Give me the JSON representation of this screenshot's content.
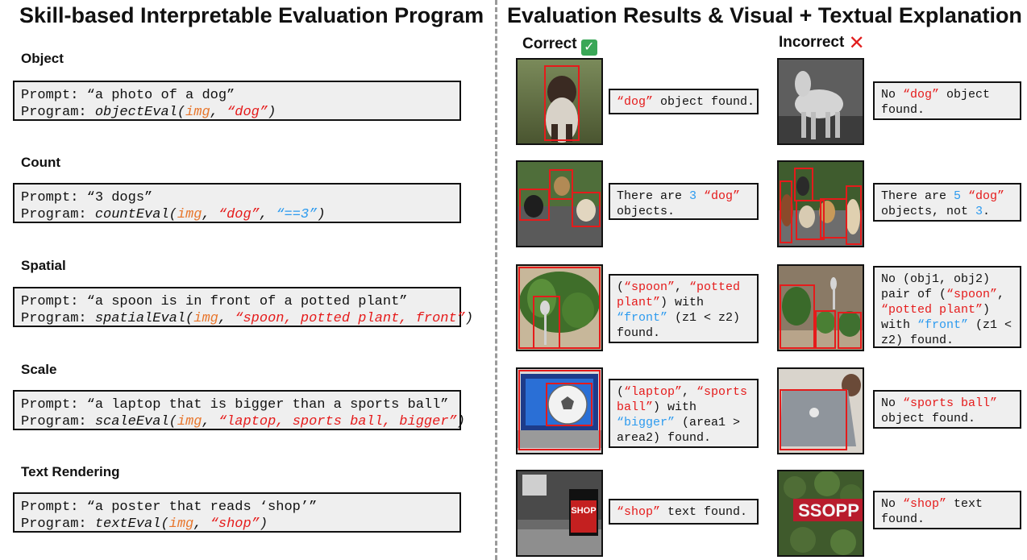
{
  "left_title": "Skill-based Interpretable Evaluation Program",
  "right_title": "Evaluation Results & Visual + Textual Explanation",
  "col_correct": "Correct",
  "col_incorrect": "Incorrect",
  "icons": {
    "correct": "check-mark-icon",
    "incorrect": "cross-mark-icon"
  },
  "colors": {
    "accent_red": "#e51b1b",
    "accent_blue": "#2d9bef",
    "accent_orange": "#e8762c"
  },
  "common": {
    "prompt_label": "Prompt:",
    "program_label": "Program:",
    "img_arg": "img",
    "comma": ", ",
    "close_paren": ")"
  },
  "skills": [
    {
      "name": "Object",
      "prompt": "“a photo of a dog”",
      "func": "objectEval(",
      "arg1": "“dog”",
      "correct": {
        "t1": "“dog”",
        "t2": " object found."
      },
      "incorrect": {
        "l1a": "No ",
        "l1b": "“dog”",
        "l1c": " object",
        "l2": "found."
      }
    },
    {
      "name": "Count",
      "prompt": "“3 dogs”",
      "func": "countEval(",
      "arg1": "“dog”",
      "arg2": "“==3”",
      "correct": {
        "l1a": "There are ",
        "l1b": "3",
        "l1c": " ",
        "l1d": "“dog”",
        "l2": "objects."
      },
      "incorrect": {
        "l1a": "There are ",
        "l1b": "5",
        "l1c": " ",
        "l1d": "“dog”",
        "l2a": "objects, not ",
        "l2b": "3",
        "l2c": "."
      }
    },
    {
      "name": "Spatial",
      "prompt": "“a spoon is in front of a potted plant”",
      "func": "spatialEval(",
      "arg1": "“spoon, potted plant, front”",
      "correct": {
        "l1a": "(",
        "l1b": "“spoon”",
        "l1c": ", ",
        "l1d": "“potted",
        "l2a": "plant”",
        "l2b": ") with",
        "l3a": "“front”",
        "l3b": " (z1 < z2)",
        "l4": "found."
      },
      "incorrect": {
        "l1": "No (obj1, obj2)",
        "l2a": "pair of (",
        "l2b": "“spoon”",
        "l2c": ",",
        "l3a": "“potted plant”",
        "l3b": ")",
        "l4a": "with ",
        "l4b": "“front”",
        "l4c": " (z1 <",
        "l5": "z2) found."
      }
    },
    {
      "name": "Scale",
      "prompt": "“a laptop that is bigger than a sports ball”",
      "func": "scaleEval(",
      "arg1": "“laptop, sports ball, bigger”",
      "correct": {
        "l1a": "(",
        "l1b": "“laptop”",
        "l1c": ", ",
        "l1d": "“sports",
        "l2a": "ball”",
        "l2b": ") with",
        "l3a": "“bigger”",
        "l3b": " (area1 >",
        "l4": "area2) found."
      },
      "incorrect": {
        "l1a": "No ",
        "l1b": "“sports ball”",
        "l2": "object found."
      }
    },
    {
      "name": "Text Rendering",
      "prompt": "“a poster that reads ‘shop’”",
      "func": "textEval(",
      "arg1": "“shop”",
      "correct": {
        "t1": "“shop”",
        "t2": " text found."
      },
      "incorrect": {
        "l1a": "No ",
        "l1b": "“shop”",
        "l1c": " text",
        "l2": "found."
      }
    }
  ],
  "image_text": {
    "shop_sign": "SHOP",
    "ssopp_sign": "SSOPP"
  }
}
